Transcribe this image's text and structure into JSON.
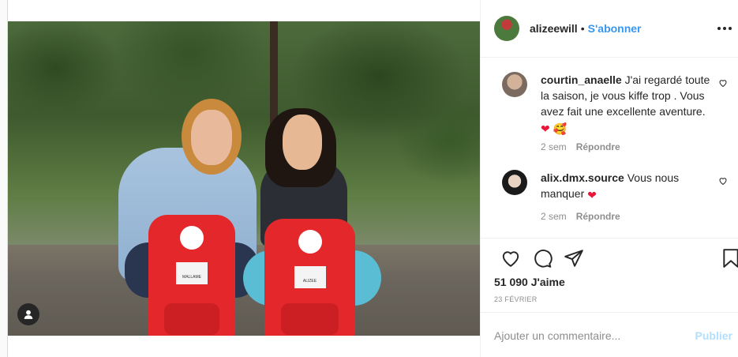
{
  "post": {
    "owner": {
      "username": "alizeewill",
      "separator": "•",
      "follow_label": "S'abonner"
    },
    "photo": {
      "bag1_tag": "MALLAME",
      "bag2_tag": "ALIZEE"
    },
    "comments": [
      {
        "username": "courtin_anaelle",
        "text": "J'ai regardé toute la saison, je vous kiffe trop . Vous avez fait une excellente aventure.",
        "emojis": [
          "❤",
          "🥰"
        ],
        "time": "2 sem",
        "reply_label": "Répondre"
      },
      {
        "username": "alix.dmx.source",
        "text": "Vous nous manquer",
        "emojis": [
          "❤"
        ],
        "time": "2 sem",
        "reply_label": "Répondre"
      }
    ],
    "likes": "51 090 J'aime",
    "date": "23 FÉVRIER",
    "add_comment": {
      "placeholder": "Ajouter un commentaire...",
      "publish_label": "Publier"
    }
  },
  "icons": [
    "heart-icon",
    "comment-icon",
    "share-icon",
    "bookmark-icon",
    "more-options-icon",
    "user-tag-icon",
    "comment-like-icon"
  ],
  "colors": {
    "accent": "#3897f0",
    "publish_disabled": "#b2dffc",
    "muted": "#8e8e8e",
    "text": "#262626"
  }
}
